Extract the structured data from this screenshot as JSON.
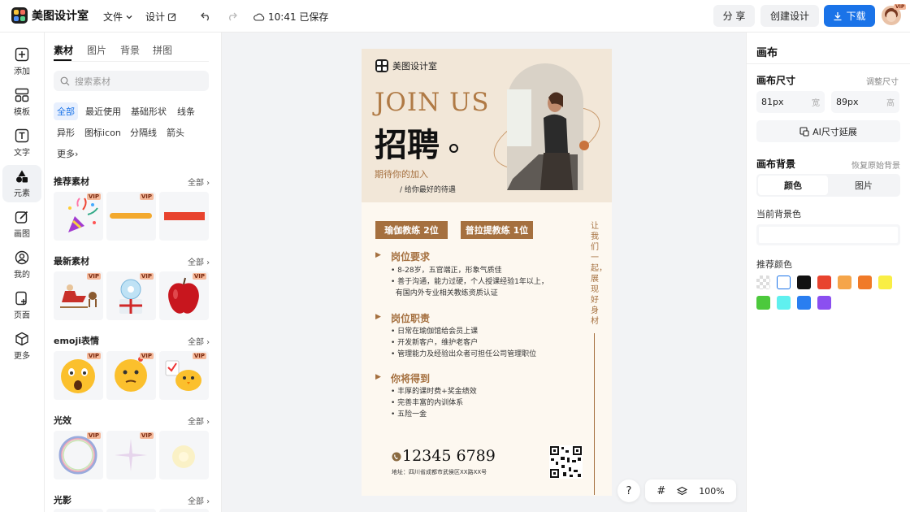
{
  "app": {
    "name": "美图设计室"
  },
  "topbar": {
    "file_menu": "文件",
    "design_menu": "设计",
    "save_status": "10:41 已保存",
    "share": "分 享",
    "create": "创建设计",
    "download": "下载",
    "vip_badge": "VIP"
  },
  "rail": [
    {
      "label": "添加",
      "icon": "plus-square-icon"
    },
    {
      "label": "模板",
      "icon": "template-icon"
    },
    {
      "label": "文字",
      "icon": "text-icon"
    },
    {
      "label": "元素",
      "icon": "shapes-icon"
    },
    {
      "label": "画图",
      "icon": "draw-icon"
    },
    {
      "label": "我的",
      "icon": "user-icon"
    },
    {
      "label": "页面",
      "icon": "page-icon"
    },
    {
      "label": "更多",
      "icon": "cube-icon"
    }
  ],
  "panel": {
    "tabs": [
      "素材",
      "图片",
      "背景",
      "拼图"
    ],
    "search_placeholder": "搜索素材",
    "chips": [
      "全部",
      "最近使用",
      "基础形状",
      "线条",
      "异形",
      "图标icon",
      "分隔线",
      "箭头",
      "更多"
    ],
    "all_label": "全部",
    "vip": "VIP",
    "sections": [
      "推荐素材",
      "最新素材",
      "emoji表情",
      "光效",
      "光影"
    ]
  },
  "poster": {
    "brand": "美图设计室",
    "join": "JOIN US",
    "headline": "招聘",
    "sub1": "期待你的加入",
    "sub2": "/ 给你最好的待遇",
    "tag1": "瑜伽教练 2位",
    "tag2": "普拉提教练 1位",
    "vertical": "让我们一起，展现好身材",
    "s1_title": "岗位要求",
    "s1_lines": [
      "• 8-28岁，五官端正，形象气质佳",
      "• 善于沟通，能力过硬，个人授课经验1年以上，",
      "  有国内外专业相关教练资质认证"
    ],
    "s2_title": "岗位职责",
    "s2_lines": [
      "• 日常在瑜伽馆给会员上课",
      "• 开发新客户，维护老客户",
      "• 管理能力及经验出众者可担任公司管理职位"
    ],
    "s3_title": "你将得到",
    "s3_lines": [
      "• 丰厚的课时费+奖金绩效",
      "• 完善丰富的内训体系",
      "• 五险一金"
    ],
    "phone": "12345 6789",
    "address": "地址：四川省成都市武侯区XX路XX号"
  },
  "canvas_tools": {
    "help": "?",
    "zoom": "100%"
  },
  "right": {
    "title": "画布",
    "size_label": "画布尺寸",
    "resize_link": "调整尺寸",
    "width_value": "81px",
    "width_unit": "宽",
    "height_value": "89px",
    "height_unit": "高",
    "ai_button": "AI尺寸延展",
    "bg_label": "画布背景",
    "restore_link": "恢复原始背景",
    "seg_color": "颜色",
    "seg_image": "图片",
    "current_bg": "当前背景色",
    "recommended": "推荐颜色",
    "colors": [
      "#ffffff",
      "#111111",
      "#e8432e",
      "#f5a54a",
      "#f07a28",
      "#f9ee45",
      "#4cc93c",
      "#5ff0ef",
      "#2a7ef0",
      "#8b4ff0"
    ]
  }
}
